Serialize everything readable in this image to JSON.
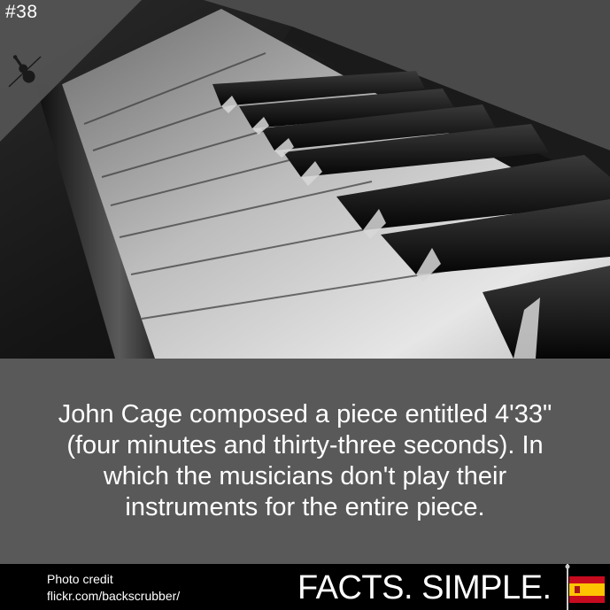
{
  "post": {
    "number": "#38",
    "icon": "violin-icon"
  },
  "photo": {
    "subject": "piano-keys-image"
  },
  "fact": {
    "text": "John Cage composed a piece entitled 4'33\" (four minutes and thirty-three seconds). In which the musicians don't play their instruments for the entire piece."
  },
  "footer": {
    "credit_label": "Photo credit",
    "credit_source": "flickr.com/backscrubber/",
    "brand": "FACTS. SIMPLE.",
    "flag_icon": "spain-flag-icon"
  },
  "colors": {
    "fact_panel": "#595959",
    "footer": "#000000",
    "text": "#ffffff",
    "flag_red": "#c60b1e",
    "flag_yellow": "#ffc400"
  }
}
